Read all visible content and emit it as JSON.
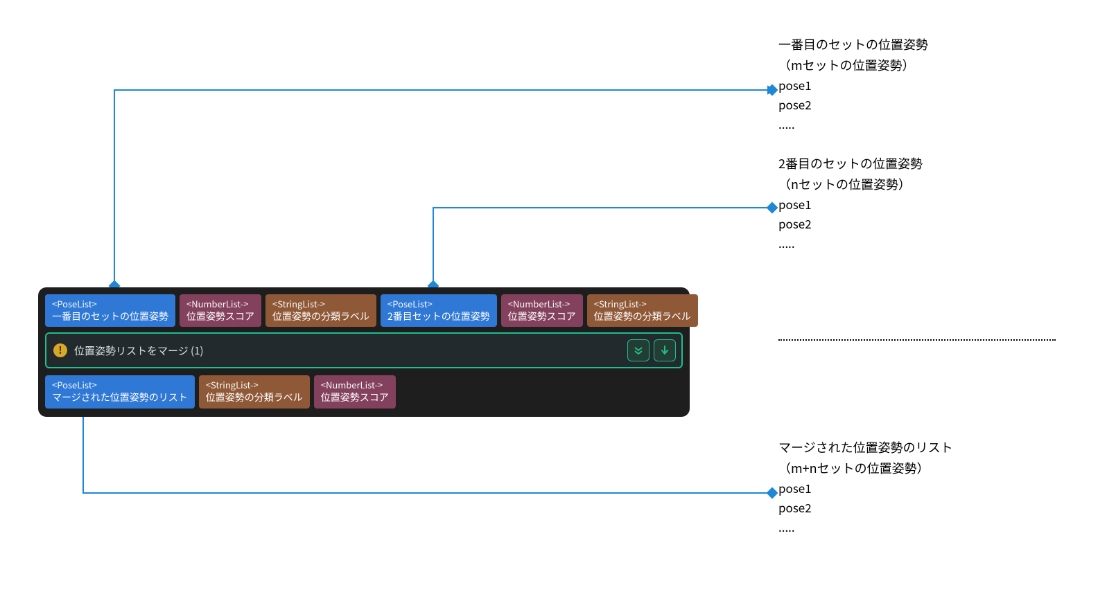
{
  "colors": {
    "connector": "#1e87d6",
    "panel_bg": "#1e1e1e",
    "accent": "#1dbf8e",
    "chip_blue": "#2f78d6",
    "chip_brown": "#8f5938",
    "chip_plum": "#83415e",
    "warn": "#d9a826"
  },
  "panel": {
    "inputs": [
      {
        "type": "<PoseList>",
        "label": "一番目のセットの位置姿勢",
        "color": "blue"
      },
      {
        "type": "<NumberList->",
        "label": "位置姿勢スコア",
        "color": "plum"
      },
      {
        "type": "<StringList->",
        "label": "位置姿勢の分類ラベル",
        "color": "brown"
      },
      {
        "type": "<PoseList>",
        "label": "2番目セットの位置姿勢",
        "color": "blue"
      },
      {
        "type": "<NumberList->",
        "label": "位置姿勢スコア",
        "color": "plum"
      },
      {
        "type": "<StringList->",
        "label": "位置姿勢の分類ラベル",
        "color": "brown"
      }
    ],
    "merge_bar": {
      "icon": "warning",
      "label": "位置姿勢リストをマージ (1)",
      "buttons": [
        {
          "name": "expand-down-icon",
          "glyph": "double-chevron-down"
        },
        {
          "name": "pull-down-icon",
          "glyph": "arrow-down"
        }
      ]
    },
    "outputs": [
      {
        "type": "<PoseList>",
        "label": "マージされた位置姿勢のリスト",
        "color": "blue"
      },
      {
        "type": "<StringList->",
        "label": "位置姿勢の分類ラベル",
        "color": "brown"
      },
      {
        "type": "<NumberList->",
        "label": "位置姿勢スコア",
        "color": "plum"
      }
    ]
  },
  "annotations": {
    "set1": {
      "title": "一番目のセットの位置姿勢",
      "subtitle": "（mセットの位置姿勢）",
      "items": [
        "pose1",
        "pose2",
        "....."
      ]
    },
    "set2": {
      "title": "2番目のセットの位置姿勢",
      "subtitle": "（nセットの位置姿勢）",
      "items": [
        "pose1",
        "pose2",
        "....."
      ]
    },
    "merged": {
      "title": "マージされた位置姿勢のリスト",
      "subtitle": "（m+nセットの位置姿勢）",
      "items": [
        "pose1",
        "pose2",
        "....."
      ]
    }
  }
}
